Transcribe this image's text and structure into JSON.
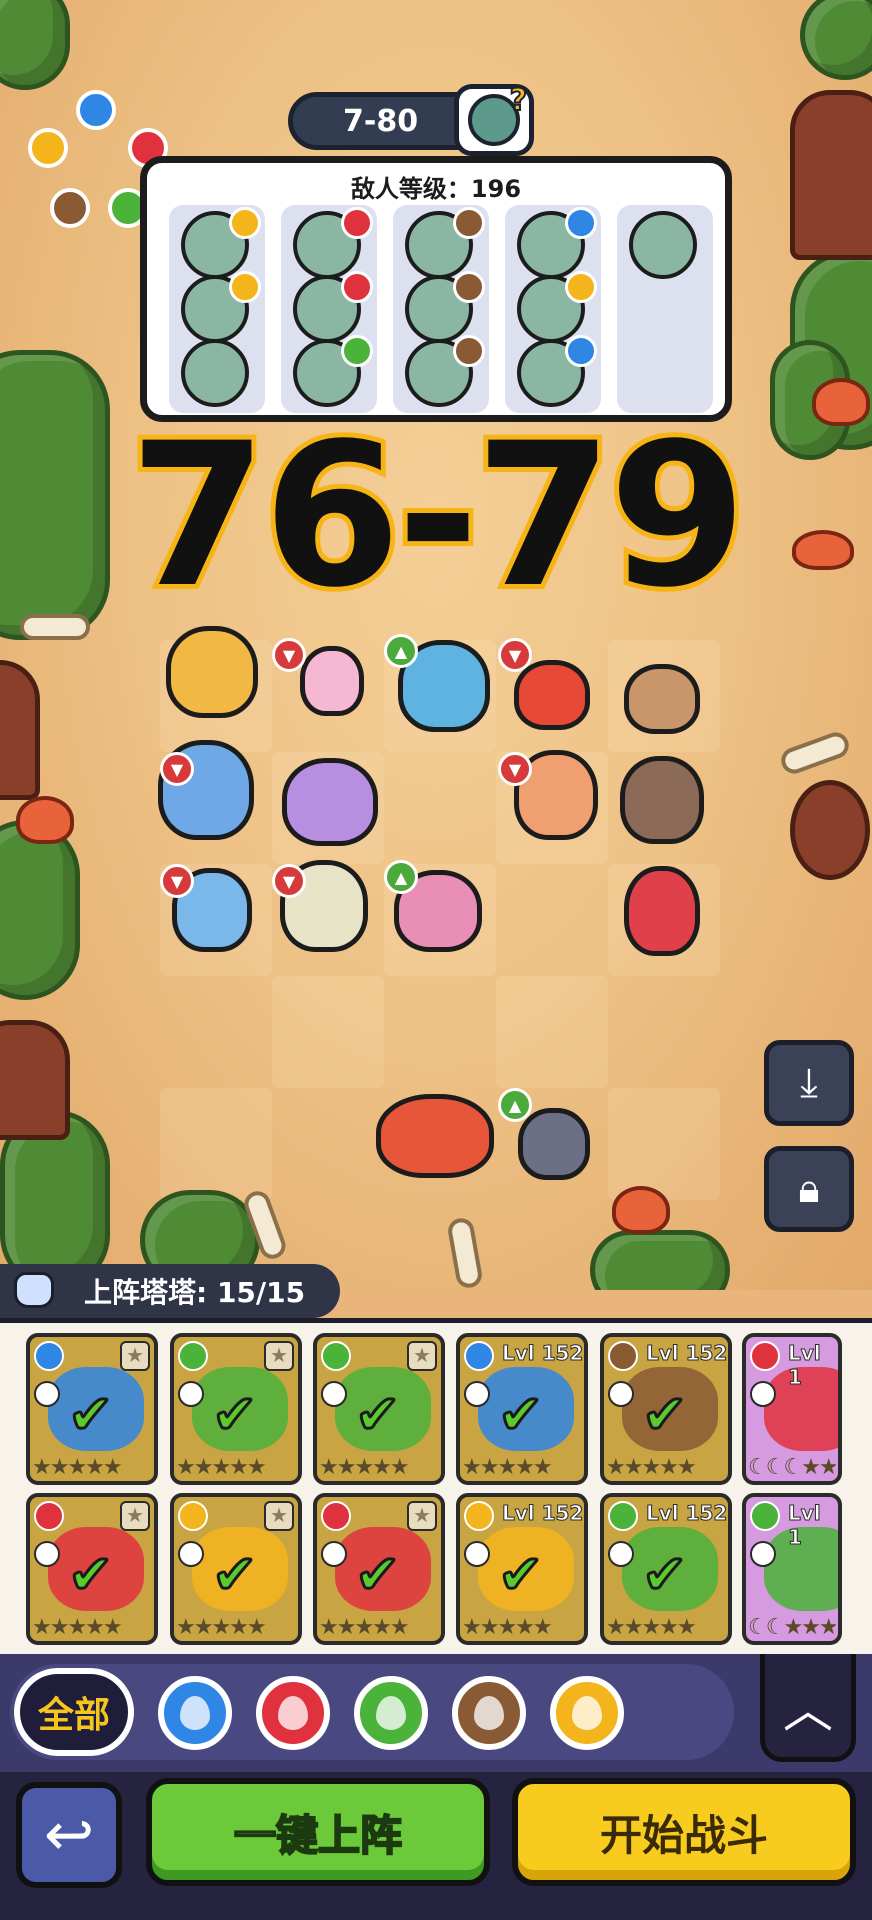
{
  "header": {
    "level": "7-80",
    "enemy_level_label": "敌人等级：196"
  },
  "overlay": {
    "range_text": "76-79"
  },
  "elements": {
    "water": "#2f86e4",
    "fire": "#e0323e",
    "grass": "#4bb23a",
    "earth": "#8a5a35",
    "thunder": "#f4b51c"
  },
  "enemy_columns": [
    {
      "enemies": [
        {
          "elem": "thunder"
        },
        {
          "elem": "thunder"
        },
        {
          "elem": ""
        }
      ]
    },
    {
      "enemies": [
        {
          "elem": "fire"
        },
        {
          "elem": "fire"
        },
        {
          "elem": "grass"
        }
      ]
    },
    {
      "enemies": [
        {
          "elem": "earth"
        },
        {
          "elem": "earth"
        },
        {
          "elem": "earth"
        }
      ]
    },
    {
      "enemies": [
        {
          "elem": "water"
        },
        {
          "elem": "thunder"
        },
        {
          "elem": "water"
        }
      ]
    },
    {
      "enemies": [
        {
          "elem": ""
        }
      ]
    }
  ],
  "towers": {
    "label": "上阵塔塔: 15/15"
  },
  "cards": [
    {
      "elem": "water",
      "lvl": "",
      "checked": true,
      "stars": "★★★★★"
    },
    {
      "elem": "grass",
      "lvl": "",
      "checked": true,
      "stars": "★★★★★"
    },
    {
      "elem": "grass",
      "lvl": "",
      "checked": true,
      "stars": "★★★★★"
    },
    {
      "elem": "water",
      "lvl": "Lvl 152",
      "checked": true,
      "stars": "★★★★★"
    },
    {
      "elem": "earth",
      "lvl": "Lvl 152",
      "checked": true,
      "stars": "★★★★★"
    },
    {
      "elem": "fire",
      "lvl": "Lvl 1",
      "checked": false,
      "stars": "☾☾☾★★"
    },
    {
      "elem": "fire",
      "lvl": "",
      "checked": true,
      "stars": "★★★★★"
    },
    {
      "elem": "thunder",
      "lvl": "",
      "checked": true,
      "stars": "★★★★★"
    },
    {
      "elem": "fire",
      "lvl": "",
      "checked": true,
      "stars": "★★★★★"
    },
    {
      "elem": "thunder",
      "lvl": "Lvl 152",
      "checked": true,
      "stars": "★★★★★"
    },
    {
      "elem": "grass",
      "lvl": "Lvl 152",
      "checked": true,
      "stars": "★★★★★"
    },
    {
      "elem": "grass",
      "lvl": "Lvl 1",
      "checked": false,
      "stars": "☾☾★★★"
    }
  ],
  "filter": {
    "all_label": "全部",
    "options": [
      "water",
      "fire",
      "grass",
      "earth",
      "thunder"
    ]
  },
  "actions": {
    "deploy_label": "一键上阵",
    "start_label": "开始战斗"
  }
}
